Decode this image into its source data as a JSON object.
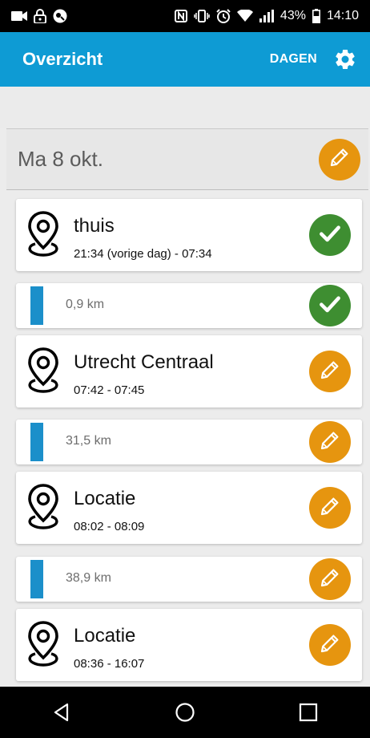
{
  "status_bar": {
    "battery_percent": "43%",
    "time": "14:10",
    "icons": [
      "video-camera-icon",
      "lock-icon",
      "app-notification-icon",
      "nfc-icon",
      "vibrate-icon",
      "alarm-icon",
      "wifi-icon",
      "signal-icon",
      "battery-icon"
    ]
  },
  "app_bar": {
    "title": "Overzicht",
    "days_button": "DAGEN",
    "settings_icon": "gear-icon"
  },
  "colors": {
    "app_bar": "#0e9bd4",
    "confirmed": "#3e8e31",
    "edit": "#e6950f",
    "distance_bar": "#1b8fca"
  },
  "day": {
    "date": "Ma 8 okt.",
    "edit_icon": "pencil-icon"
  },
  "entries": [
    {
      "type": "location",
      "name": "thuis",
      "time": "21:34 (vorige dag) - 07:34",
      "status": "confirmed"
    },
    {
      "type": "distance",
      "distance": "0,9 km",
      "status": "confirmed"
    },
    {
      "type": "location",
      "name": "Utrecht Centraal",
      "time": "07:42 - 07:45",
      "status": "edit"
    },
    {
      "type": "distance",
      "distance": "31,5 km",
      "status": "edit"
    },
    {
      "type": "location",
      "name": "Locatie",
      "time": "08:02 - 08:09",
      "status": "edit"
    },
    {
      "type": "distance",
      "distance": "38,9 km",
      "status": "edit"
    },
    {
      "type": "location",
      "name": "Locatie",
      "time": "08:36 - 16:07",
      "status": "edit"
    }
  ],
  "nav_bar": {
    "buttons": [
      "back-icon",
      "home-icon",
      "recents-icon"
    ]
  }
}
